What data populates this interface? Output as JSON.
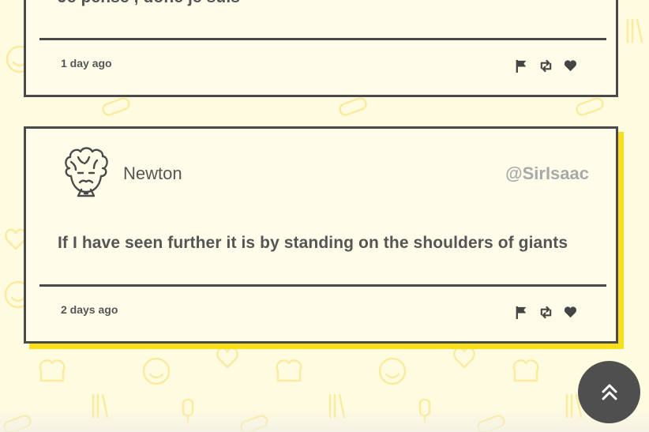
{
  "colors": {
    "background": "#fffbe0",
    "card_border": "#4a4a4a",
    "card_shadow": "#f7df1e",
    "handle": "#a9a9a9",
    "pattern_icons": "#f7df1e"
  },
  "feed": {
    "tweets": [
      {
        "text": "Je pense , donc je suis",
        "time": "1 day ago"
      },
      {
        "name": "Newton",
        "handle": "@SirIsaac",
        "text": "If I have seen further it is by standing on the shoulders of giants",
        "time": "2 days ago"
      }
    ]
  },
  "icons": {
    "report": "flag-icon",
    "retweet": "retweet-icon",
    "like": "heart-icon",
    "scroll_top": "double-chevron-up-icon",
    "avatar": "curly-haired-man-avatar"
  }
}
